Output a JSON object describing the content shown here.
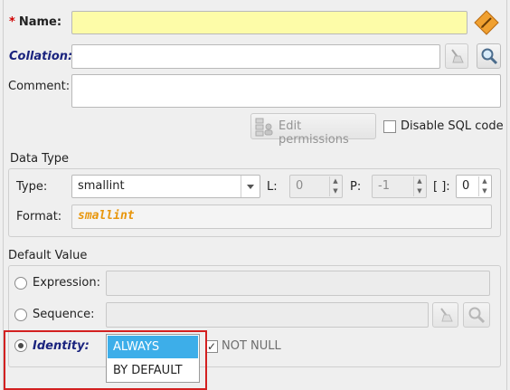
{
  "form": {
    "name_required_mark": "*",
    "name_label": "Name:",
    "name_value": "",
    "collation_label": "Collation:",
    "collation_value": "",
    "comment_label": "Comment:",
    "comment_value": "",
    "edit_permissions_label": "Edit permissions",
    "disable_sql_label": "Disable SQL code",
    "disable_sql_checked": false
  },
  "data_type": {
    "section_label": "Data Type",
    "type_label": "Type:",
    "type_value": "smallint",
    "length_label": "L:",
    "length_value": "0",
    "precision_label": "P:",
    "precision_value": "-1",
    "dimension_label": "[ ]:",
    "dimension_value": "0",
    "format_label": "Format:",
    "format_value": "smallint",
    "format_color": "#e8960c"
  },
  "default_value": {
    "section_label": "Default Value",
    "expression_label": "Expression:",
    "expression_value": "",
    "sequence_label": "Sequence:",
    "sequence_value": "",
    "identity_label": "Identity:",
    "identity_selected": true,
    "identity_options": [
      "ALWAYS",
      "BY DEFAULT"
    ],
    "identity_selected_option": "ALWAYS",
    "not_null_label": "NOT NULL",
    "not_null_checked": true
  },
  "icons": {
    "name_action": "diamond-edit-icon",
    "collation_clear": "eraser-icon",
    "collation_search": "magnifier-icon",
    "permissions": "permissions-icon",
    "sequence_clear": "eraser-icon",
    "sequence_search": "magnifier-icon"
  },
  "colors": {
    "name_field_bg": "#fdfca8",
    "required_mark": "#d00000",
    "accent_label": "#1a237e",
    "dropdown_selected": "#3daee9",
    "highlight_border": "#d32020"
  }
}
